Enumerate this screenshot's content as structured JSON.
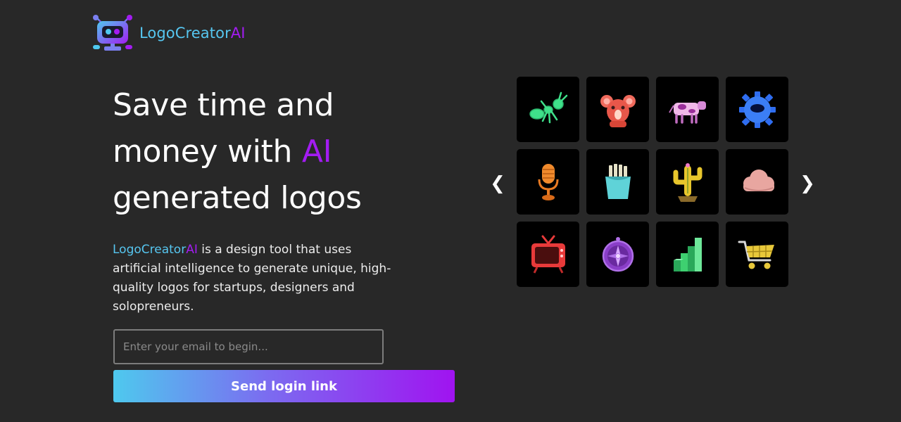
{
  "brand": {
    "name_main": "LogoCreator",
    "name_ai": "AI",
    "icon": "robot-logo-icon"
  },
  "hero": {
    "title_line1": "Save time and",
    "title_line2_prefix": "money with ",
    "title_line2_ai": "AI",
    "title_line3": "generated logos"
  },
  "description": {
    "brand_main": "LogoCreator",
    "brand_ai": "AI",
    "text": " is a design tool that uses artificial intelligence to generate unique, high-quality logos for startups, designers and solopreneurs."
  },
  "form": {
    "email_placeholder": "Enter your email to begin...",
    "email_value": "",
    "submit_label": "Send login link"
  },
  "carousel": {
    "prev_label": "❮",
    "next_label": "❯",
    "tiles": [
      {
        "icon": "ant-icon",
        "color": "#3fe08a"
      },
      {
        "icon": "koala-icon",
        "color": "#e8574a"
      },
      {
        "icon": "cow-icon",
        "color": "#d88bd8"
      },
      {
        "icon": "gear-icon",
        "color": "#2f6df0"
      },
      {
        "icon": "microphone-icon",
        "color": "#f08a2c"
      },
      {
        "icon": "fries-icon",
        "color": "#5fd3d8"
      },
      {
        "icon": "cactus-icon",
        "color": "#e8c62c"
      },
      {
        "icon": "cloud-icon",
        "color": "#e8a6a0"
      },
      {
        "icon": "tv-icon",
        "color": "#e83a3a"
      },
      {
        "icon": "compass-icon",
        "color": "#8a3ec8"
      },
      {
        "icon": "bar-chart-icon",
        "color": "#3ed070"
      },
      {
        "icon": "shopping-cart-icon",
        "color": "#e8c83a"
      }
    ]
  },
  "colors": {
    "background": "#282828",
    "accent_blue": "#56c6f0",
    "accent_purple": "#a31cf2"
  }
}
